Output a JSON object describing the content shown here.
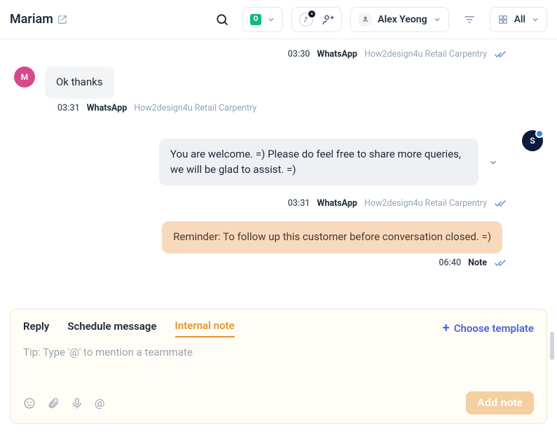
{
  "header": {
    "contact_name": "Mariam",
    "status_badge": "O",
    "assignee_name": "Alex Yeong",
    "view_filter_label": "All"
  },
  "messages": {
    "meta0": {
      "time": "03:30",
      "channel": "WhatsApp",
      "source": "How2design4u Retail Carpentry"
    },
    "in1": {
      "avatar": "M",
      "text": "Ok thanks"
    },
    "meta1": {
      "time": "03:31",
      "channel": "WhatsApp",
      "source": "How2design4u Retail Carpentry"
    },
    "out1": {
      "avatar": "S",
      "text": "You are welcome. =) Please do feel free to share more queries, we will be glad to assist. =)"
    },
    "meta2": {
      "time": "03:31",
      "channel": "WhatsApp",
      "source": "How2design4u Retail Carpentry"
    },
    "note1": {
      "text": "Reminder: To follow up this customer before conversation closed. =)"
    },
    "meta3": {
      "time": "06:40",
      "channel": "Note"
    }
  },
  "composer": {
    "tab_reply": "Reply",
    "tab_schedule": "Schedule message",
    "tab_note": "Internal note",
    "template_link": "Choose template",
    "placeholder": "Tip: Type '@' to mention a teammate",
    "submit_label": "Add note"
  }
}
